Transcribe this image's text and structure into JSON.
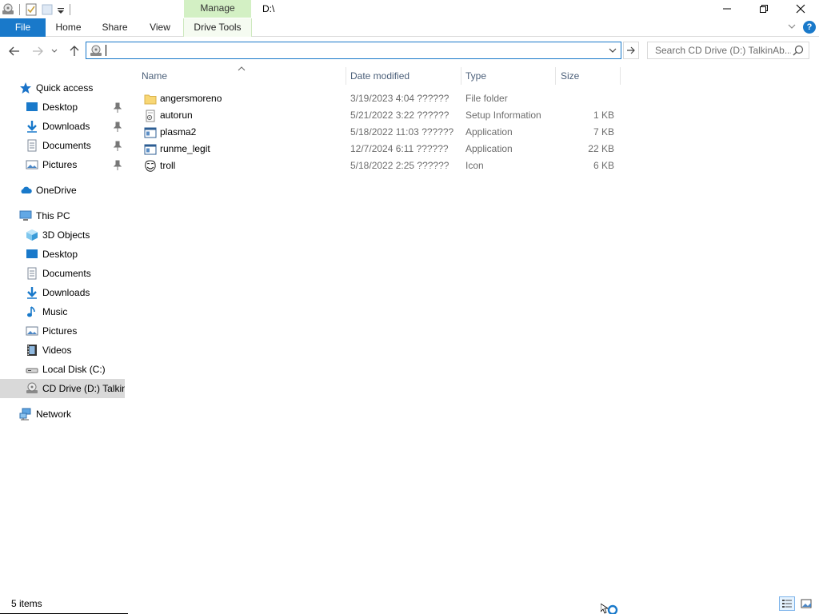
{
  "title_bar": {
    "path": "D:\\",
    "contextual_tab_group": "Manage"
  },
  "ribbon": {
    "tabs": [
      "File",
      "Home",
      "Share",
      "View",
      "Drive Tools"
    ]
  },
  "address_bar": {
    "value": ""
  },
  "search": {
    "placeholder": "Search CD Drive (D:) TalkinAb..."
  },
  "nav_pane": {
    "quick_access": {
      "label": "Quick access",
      "items": [
        "Desktop",
        "Downloads",
        "Documents",
        "Pictures"
      ]
    },
    "onedrive": "OneDrive",
    "this_pc": {
      "label": "This PC",
      "items": [
        "3D Objects",
        "Desktop",
        "Documents",
        "Downloads",
        "Music",
        "Pictures",
        "Videos",
        "Local Disk (C:)",
        "CD Drive (D:) TalkinA"
      ]
    },
    "network": "Network"
  },
  "columns": [
    "Name",
    "Date modified",
    "Type",
    "Size"
  ],
  "files": [
    {
      "name": "angersmoreno",
      "date": "3/19/2023 4:04 ??????",
      "type": "File folder",
      "size": "",
      "icon": "folder-icon"
    },
    {
      "name": "autorun",
      "date": "5/21/2022 3:22 ??????",
      "type": "Setup Information",
      "size": "1 KB",
      "icon": "setup-info-icon"
    },
    {
      "name": "plasma2",
      "date": "5/18/2022 11:03 ??????",
      "type": "Application",
      "size": "7 KB",
      "icon": "application-icon"
    },
    {
      "name": "runme_legit",
      "date": "12/7/2024 6:11 ??????",
      "type": "Application",
      "size": "22 KB",
      "icon": "application-icon"
    },
    {
      "name": "troll",
      "date": "5/18/2022 2:25 ??????",
      "type": "Icon",
      "size": "6 KB",
      "icon": "troll-face-icon"
    }
  ],
  "status": {
    "item_count": "5 items"
  },
  "colors": {
    "accent": "#1979ca",
    "manage_tab": "#d3f0c4",
    "nav_selected": "#d9d9d9",
    "secondary_text": "#6d6d6d"
  }
}
